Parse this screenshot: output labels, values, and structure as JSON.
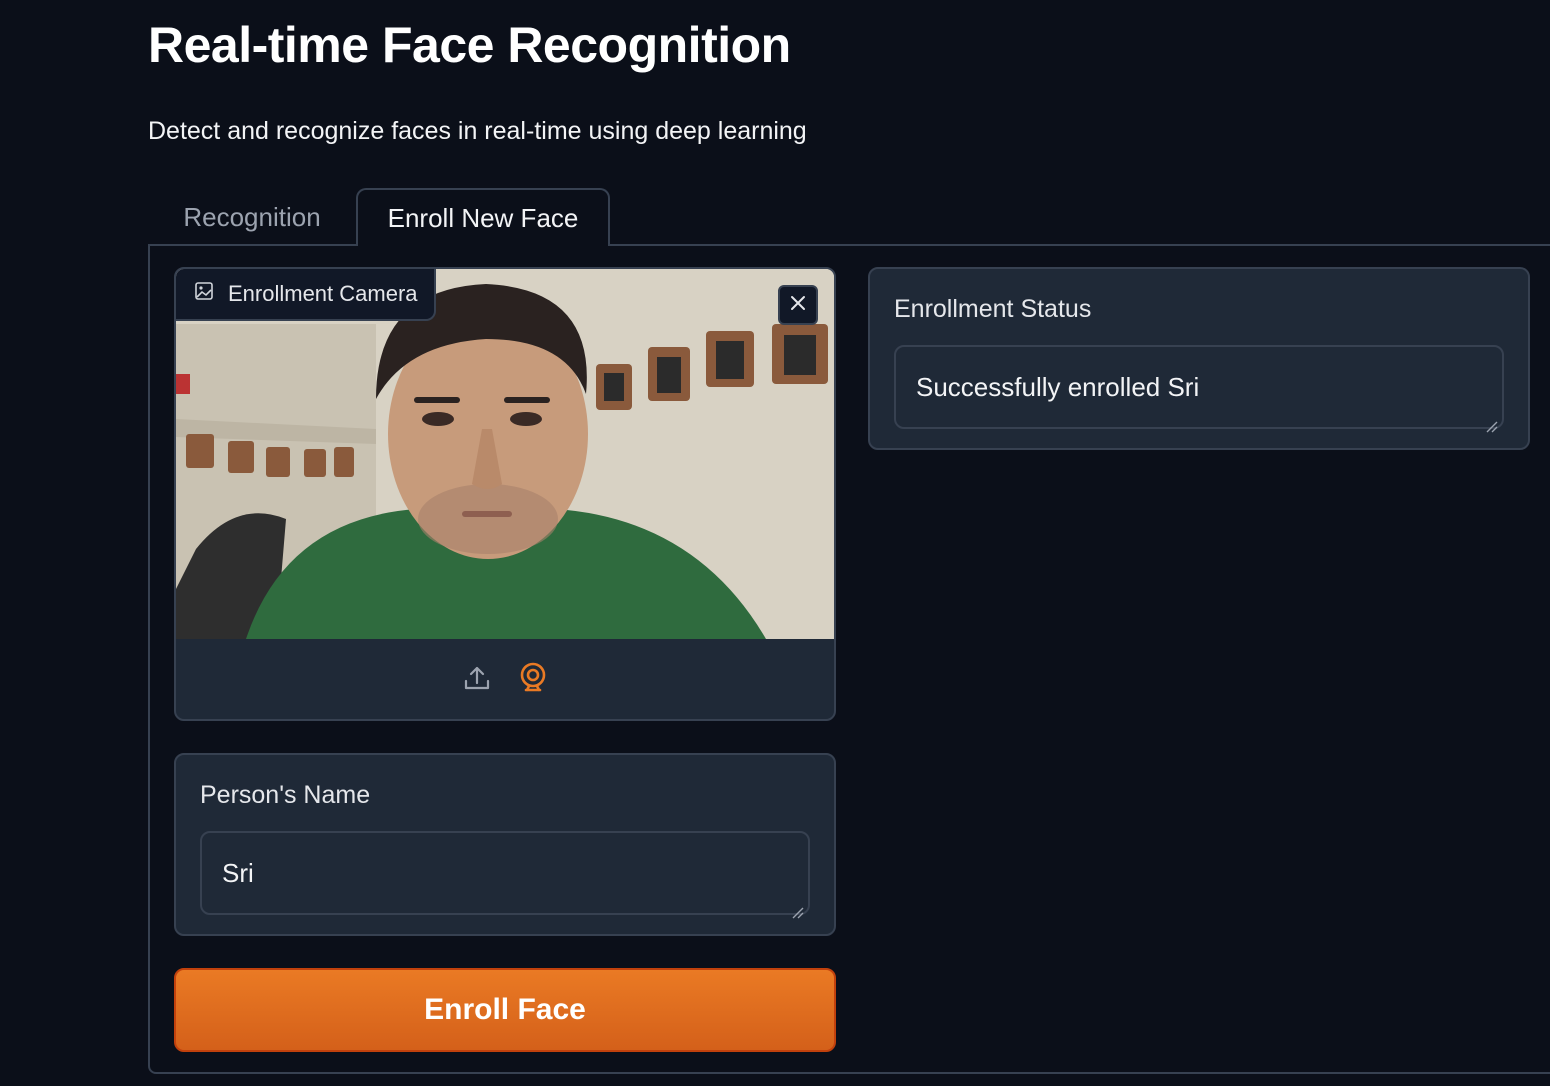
{
  "header": {
    "title": "Real-time Face Recognition",
    "subtitle": "Detect and recognize faces in real-time using deep learning"
  },
  "tabs": [
    {
      "label": "Recognition",
      "active": false
    },
    {
      "label": "Enroll New Face",
      "active": true
    }
  ],
  "camera": {
    "label": "Enrollment Camera",
    "label_icon": "image-icon",
    "clear_icon": "close-icon",
    "sources": [
      {
        "icon": "upload-icon",
        "active": false
      },
      {
        "icon": "webcam-icon",
        "active": true
      }
    ]
  },
  "name_field": {
    "label": "Person's Name",
    "value": "Sri"
  },
  "enroll_button": {
    "label": "Enroll Face"
  },
  "status": {
    "label": "Enrollment Status",
    "value": "Successfully enrolled Sri"
  },
  "colors": {
    "background": "#0b0f19",
    "panel": "#1f2937",
    "border": "#374151",
    "accent": "#ea7a24"
  }
}
